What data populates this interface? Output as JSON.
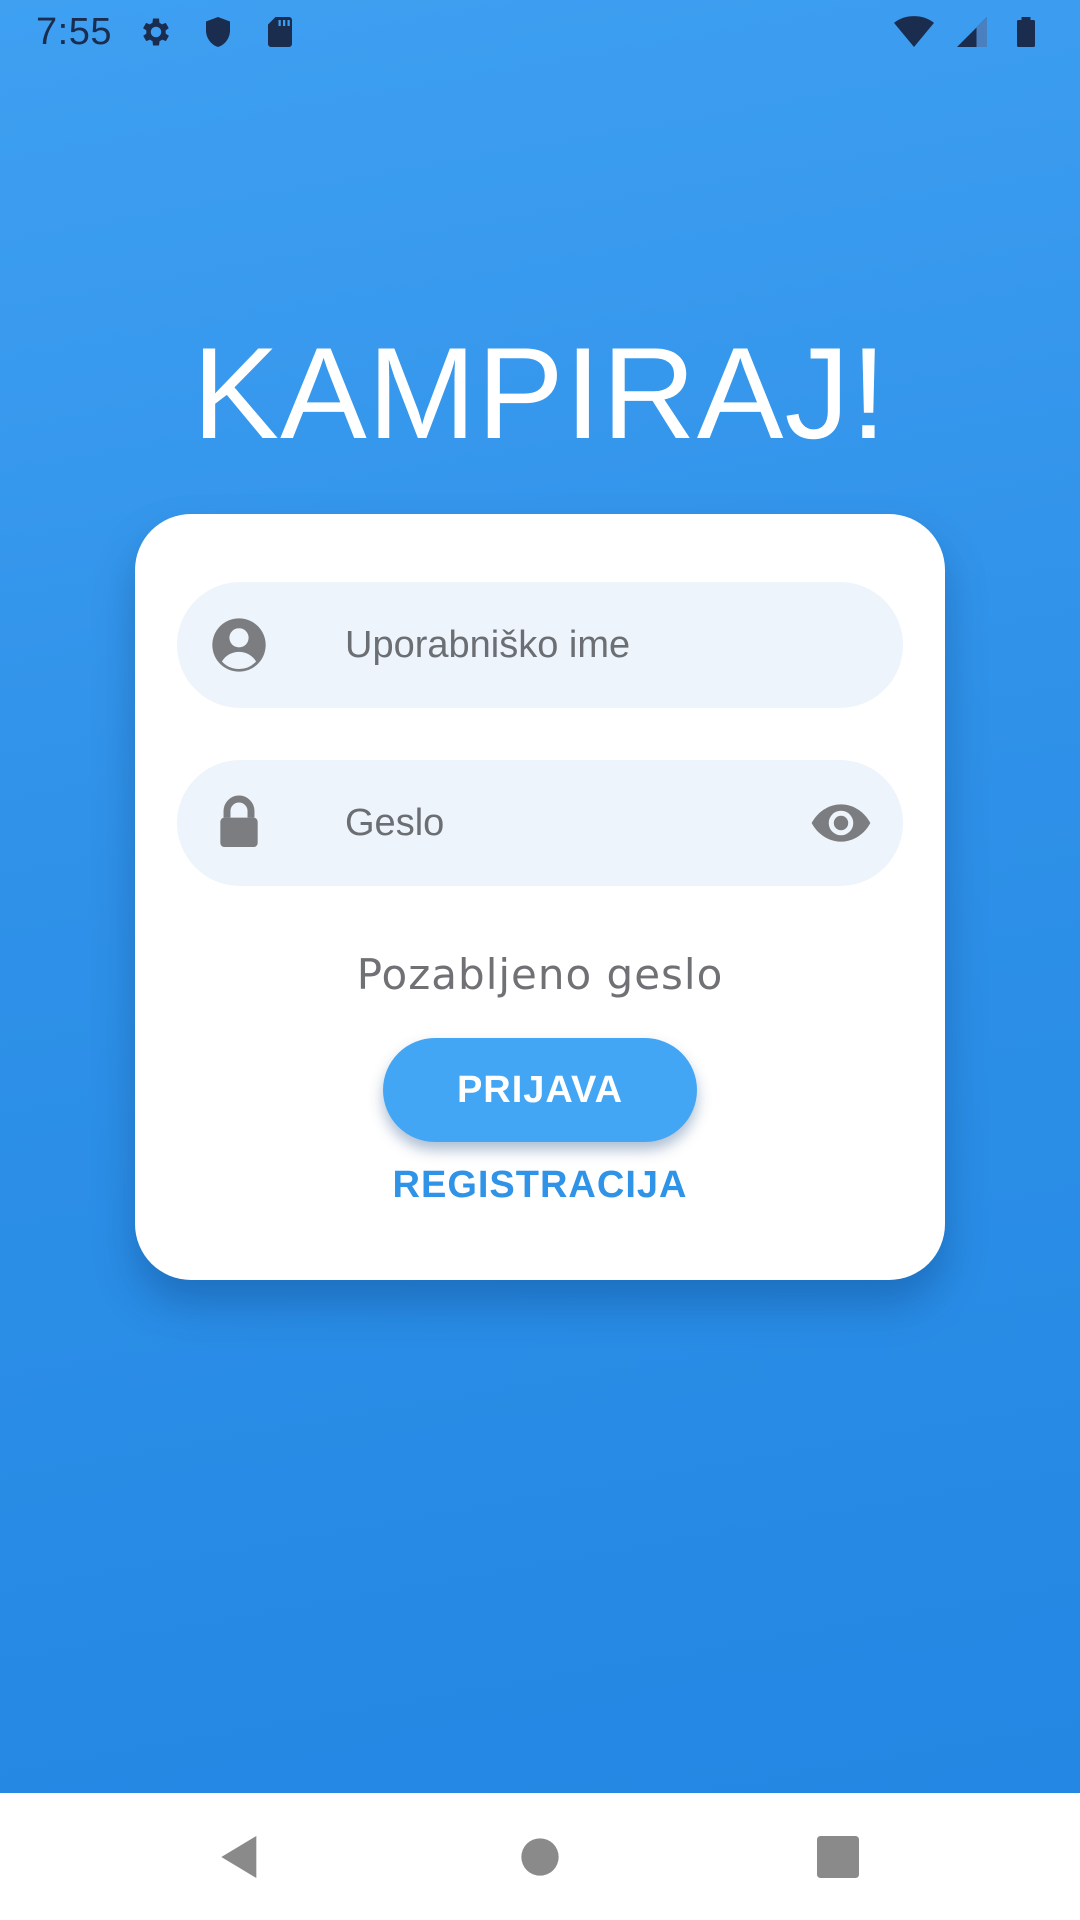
{
  "status_bar": {
    "time": "7:55",
    "left_icons": [
      "gear-icon",
      "shield-icon",
      "sd-card-icon"
    ],
    "right_icons": [
      "wifi-icon",
      "cellular-signal-icon",
      "battery-icon"
    ]
  },
  "app": {
    "title": "KAMPIRAJ!"
  },
  "login_form": {
    "username": {
      "placeholder": "Uporabniško ime",
      "icon": "user-avatar-icon"
    },
    "password": {
      "placeholder": "Geslo",
      "icon": "lock-icon",
      "toggle_icon": "eye-icon"
    },
    "forgot_password_label": "Pozabljeno geslo",
    "login_button_label": "PRIJAVA",
    "register_button_label": "REGISTRACIJA"
  },
  "nav_bar": {
    "buttons": [
      "back-icon",
      "home-icon",
      "recents-icon"
    ]
  },
  "colors": {
    "background": "#2f91e8",
    "primary_button": "#43a6f4",
    "link": "#2f93e8",
    "field_bg": "#edf4fb"
  }
}
